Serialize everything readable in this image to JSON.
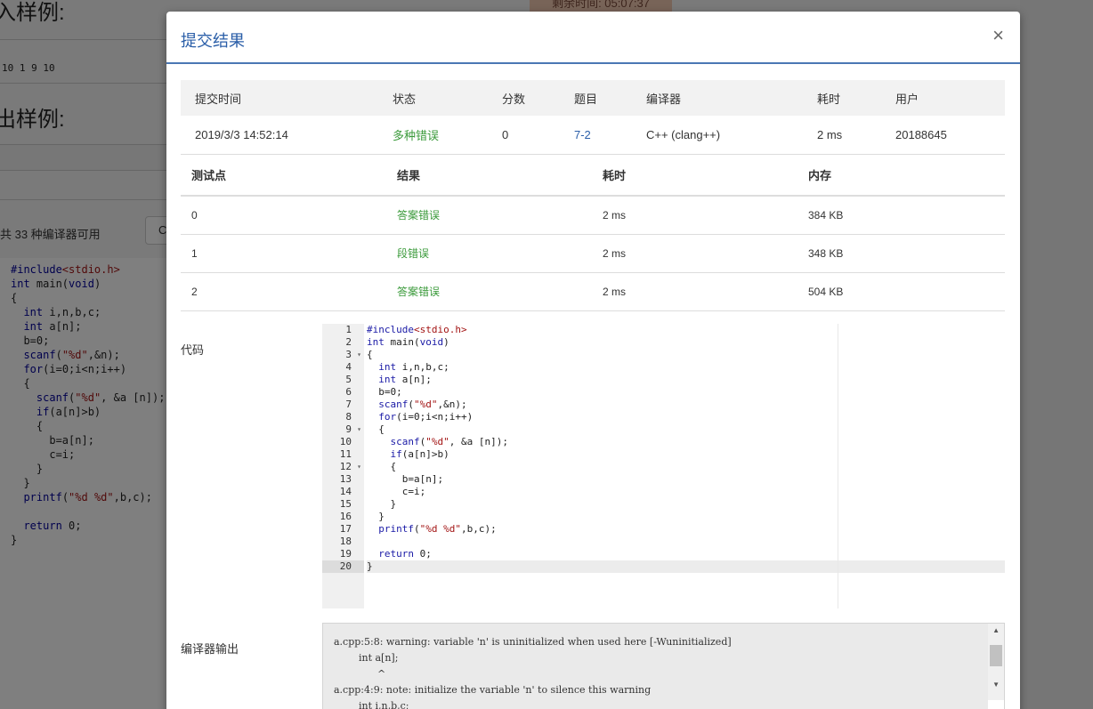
{
  "background": {
    "heading_input": "入样例:",
    "sample_input": "10 1 9 10",
    "heading_output": "出样例:",
    "compiler_count": "共 33 种编译器可用",
    "select_initial": "C",
    "timer": "剩余时间: 05:07:37",
    "code": [
      "#include<stdio.h>",
      "int main(void)",
      "{",
      "  int i,n,b,c;",
      "  int a[n];",
      "  b=0;",
      "  scanf(\"%d\",&n);",
      "  for(i=0;i<n;i++)",
      "  {",
      "    scanf(\"%d\", &a [n]);",
      "    if(a[n]>b)",
      "    {",
      "      b=a[n];",
      "      c=i;",
      "    }",
      "  }",
      "  printf(\"%d %d\",b,c);",
      "",
      "  return 0;",
      "}"
    ]
  },
  "modal": {
    "title": "提交结果",
    "close": "×",
    "submission": {
      "headers": [
        "提交时间",
        "状态",
        "分数",
        "题目",
        "编译器",
        "耗时",
        "用户"
      ],
      "row": {
        "time": "2019/3/3 14:52:14",
        "status": "多种错误",
        "score": "0",
        "problem": "7-2",
        "compiler": "C++ (clang++)",
        "duration": "2 ms",
        "user": "20188645"
      }
    },
    "cases": {
      "headers": [
        "测试点",
        "结果",
        "耗时",
        "内存"
      ],
      "rows": [
        {
          "id": "0",
          "result": "答案错误",
          "time": "2 ms",
          "memory": "384 KB"
        },
        {
          "id": "1",
          "result": "段错误",
          "time": "2 ms",
          "memory": "348 KB"
        },
        {
          "id": "2",
          "result": "答案错误",
          "time": "2 ms",
          "memory": "504 KB"
        }
      ]
    },
    "code_label": "代码",
    "compiler_output_label": "编译器输出",
    "compiler_output": "a.cpp:5:8: warning: variable 'n' is uninitialized when used here [-Wuninitialized]\n        int a[n];\n              ^\na.cpp:4:9: note: initialize the variable 'n' to silence this warning\n        int i,n,b,c;"
  },
  "colors": {
    "accent": "#2a5ea8",
    "success": "#3a9a3a",
    "header_border": "#4a77b4"
  }
}
